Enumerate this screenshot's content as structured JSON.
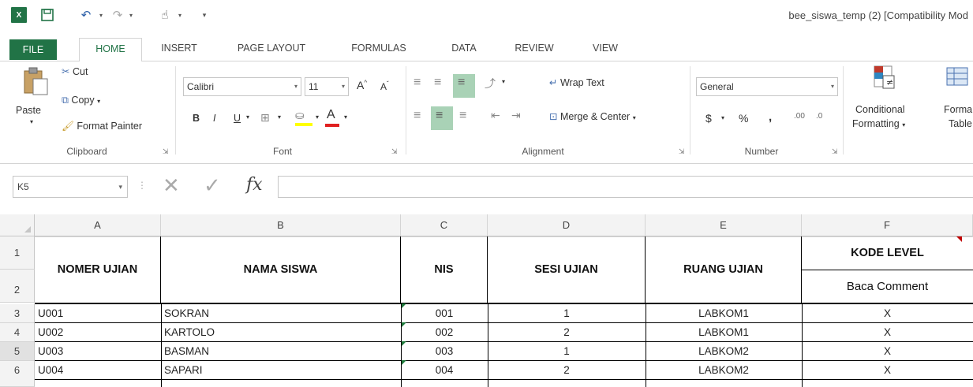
{
  "window": {
    "title": "bee_siswa_temp (2)  [Compatibility Mod",
    "app_icon": "excel-icon"
  },
  "qat": {
    "save_icon": "save-icon",
    "undo_icon": "undo-icon",
    "redo_icon": "redo-icon",
    "touch_icon": "touch-mode-icon"
  },
  "tabs": [
    "FILE",
    "HOME",
    "INSERT",
    "PAGE LAYOUT",
    "FORMULAS",
    "DATA",
    "REVIEW",
    "VIEW"
  ],
  "ribbon": {
    "clipboard": {
      "label": "Clipboard",
      "paste": "Paste",
      "cut": "Cut",
      "copy": "Copy",
      "format_painter": "Format Painter"
    },
    "font": {
      "label": "Font",
      "name": "Calibri",
      "size": "11",
      "bold": "B",
      "italic": "I",
      "underline": "U"
    },
    "alignment": {
      "label": "Alignment",
      "wrap_text": "Wrap Text",
      "merge_center": "Merge & Center"
    },
    "number": {
      "label": "Number",
      "format": "General",
      "currency": "$",
      "percent": "%",
      "comma": ",",
      "inc_dec": ".00",
      "dec_dec": ".0"
    },
    "styles": {
      "conditional_formatting": "Conditional",
      "conditional_formatting_2": "Formatting",
      "format_table": "Forma",
      "format_table_2": "Table"
    },
    "accent_color": "#217346"
  },
  "formula_bar": {
    "name_box": "K5",
    "fx": "fx",
    "value": ""
  },
  "sheet": {
    "columns": [
      "A",
      "B",
      "C",
      "D",
      "E",
      "F"
    ],
    "rows": [
      "1",
      "2",
      "3",
      "4",
      "5",
      "6"
    ],
    "headers": {
      "nomer_ujian": "NOMER UJIAN",
      "nama_siswa": "NAMA SISWA",
      "nis": "NIS",
      "sesi_ujian": "SESI UJIAN",
      "ruang_ujian": "RUANG UJIAN",
      "kode_level": "KODE LEVEL",
      "baca_comment": "Baca Comment"
    },
    "data": [
      {
        "nomer": "U001",
        "nama": "SOKRAN",
        "nis": "001",
        "sesi": "1",
        "ruang": "LABKOM1",
        "kode": "X"
      },
      {
        "nomer": "U002",
        "nama": "KARTOLO",
        "nis": "002",
        "sesi": "2",
        "ruang": "LABKOM1",
        "kode": "X"
      },
      {
        "nomer": "U003",
        "nama": "BASMAN",
        "nis": "003",
        "sesi": "1",
        "ruang": "LABKOM2",
        "kode": "X"
      },
      {
        "nomer": "U004",
        "nama": "SAPARI",
        "nis": "004",
        "sesi": "2",
        "ruang": "LABKOM2",
        "kode": "X"
      }
    ]
  }
}
